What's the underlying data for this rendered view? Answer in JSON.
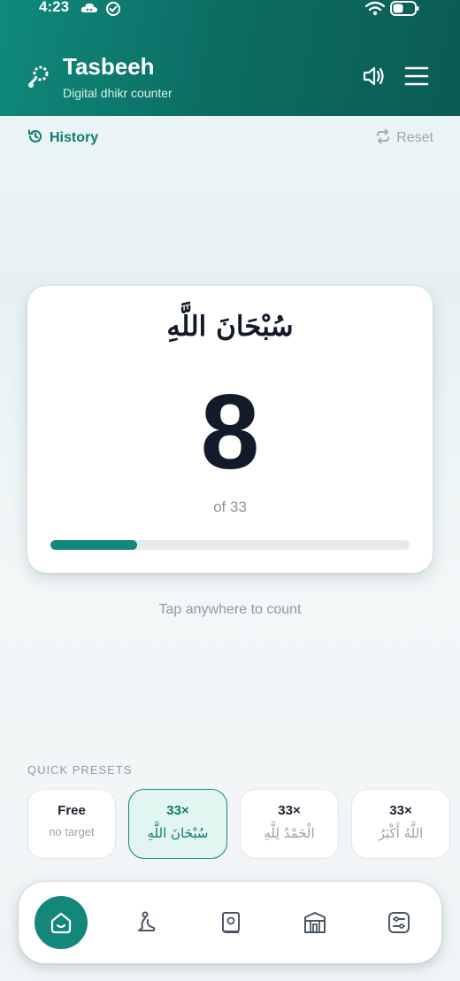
{
  "status_bar": {
    "time": "4:23"
  },
  "header": {
    "title": "Tasbeeh",
    "subtitle": "Digital dhikr counter",
    "icons": [
      "prayer-beads-icon",
      "speaker-icon",
      "menu-icon"
    ]
  },
  "toolbar": {
    "history_label": "History",
    "reset_label": "Reset"
  },
  "counter_card": {
    "dhikr_arabic": "سُبْحَانَ اللَّهِ",
    "count": "8",
    "target_text": "of 33",
    "progress_fraction": 0.2424
  },
  "hint": "Tap anywhere to count",
  "presets": {
    "label": "QUICK PRESETS",
    "items": [
      {
        "top": "Free",
        "bottom": "no target",
        "active": false
      },
      {
        "top": "33×",
        "bottom": "سُبْحَانَ اللَّهِ",
        "active": true
      },
      {
        "top": "33×",
        "bottom": "الْحَمْدُ لِلَّهِ",
        "active": false
      },
      {
        "top": "33×",
        "bottom": "اللَّهُ أَكْبَرُ",
        "active": false
      }
    ]
  },
  "bottom_nav": {
    "items": [
      "home-icon",
      "prayer-icon",
      "quran-icon",
      "kaaba-icon",
      "settings-icon"
    ],
    "active_index": 0
  },
  "colors": {
    "accent": "#13877a",
    "header_start": "#0f8a7c",
    "header_end": "#0b5b53"
  }
}
